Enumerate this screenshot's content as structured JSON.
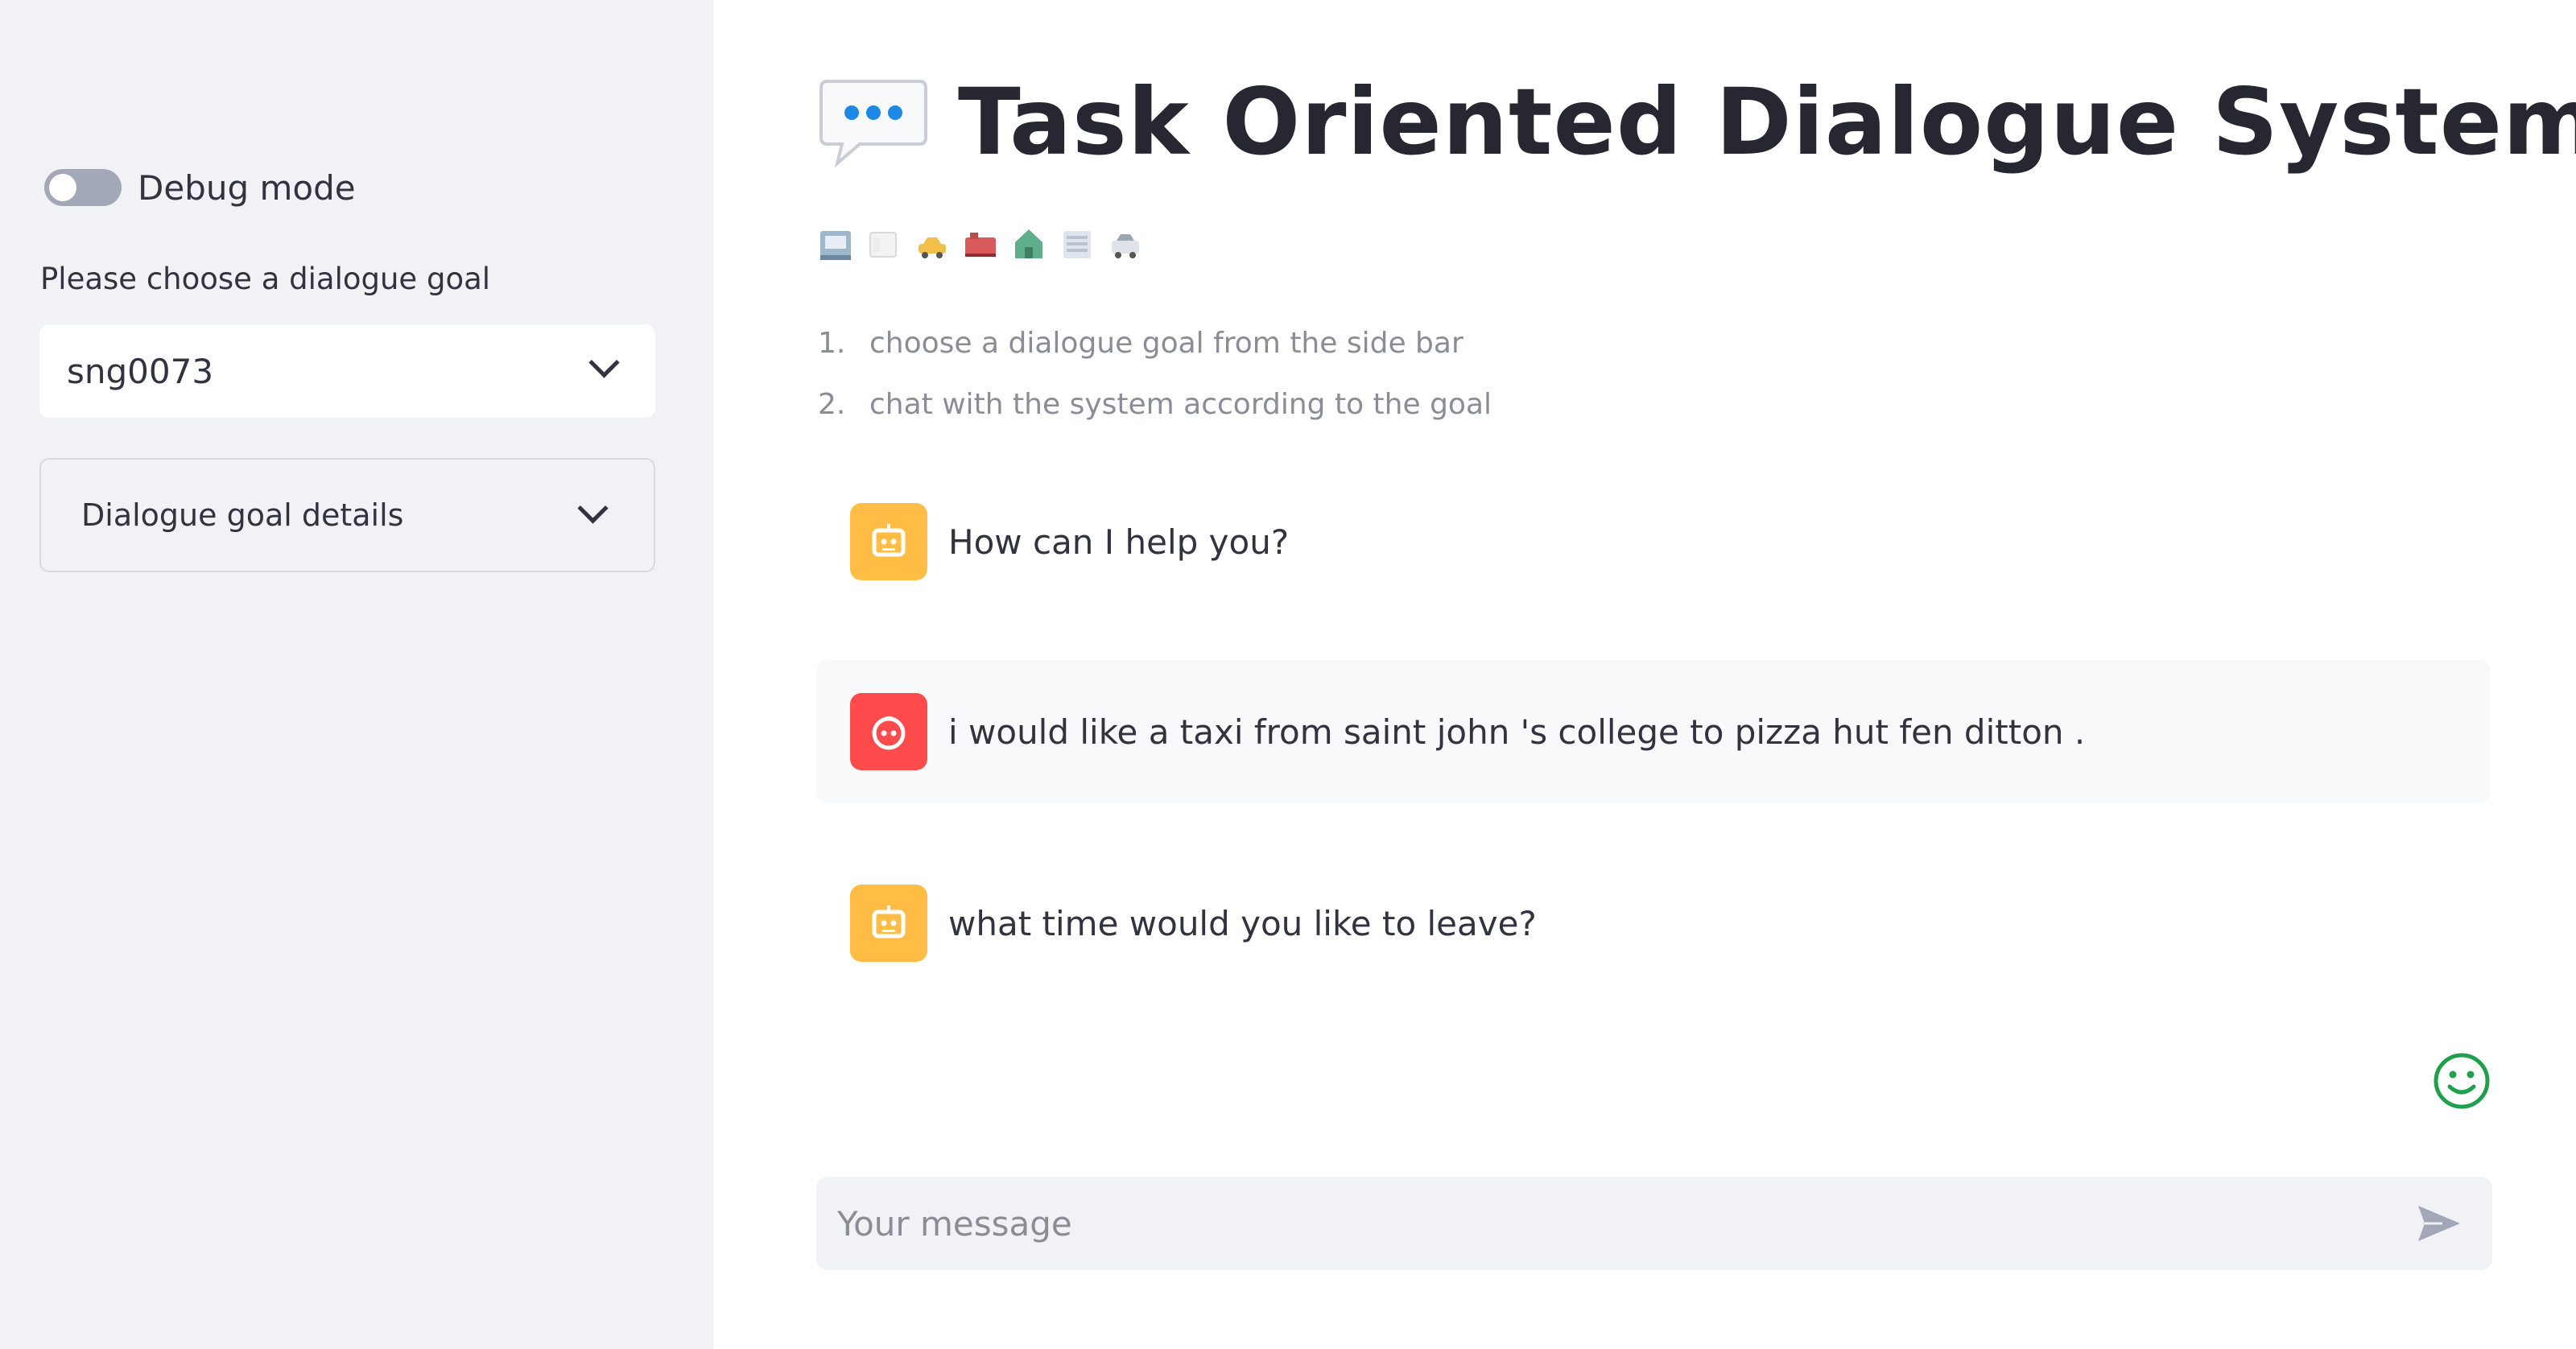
{
  "sidebar": {
    "debug_toggle": {
      "label": "Debug mode",
      "checked": false
    },
    "goal_select": {
      "label": "Please choose a dialogue goal",
      "value": "sng0073",
      "icon": "chevron-down-icon"
    },
    "goal_expander": {
      "label": "Dialogue goal details",
      "icon": "chevron-down-icon"
    }
  },
  "main": {
    "title": "Task Oriented Dialogue System",
    "title_icon": "speech-bubble-icon",
    "domain_icons": [
      "hotel-icon",
      "restaurant-icon",
      "taxi-icon",
      "train-icon",
      "attraction-icon",
      "hospital-icon",
      "police-icon"
    ],
    "instructions": [
      {
        "num": "1.",
        "text": "choose a dialogue goal from the side bar"
      },
      {
        "num": "2.",
        "text": "chat with the system according to the goal"
      }
    ],
    "messages": [
      {
        "role": "assistant",
        "text": "How can I help you?"
      },
      {
        "role": "user",
        "text": "i would like a taxi from saint john 's college to pizza hut fen ditton ."
      },
      {
        "role": "assistant",
        "text": "what time would you like to leave?"
      }
    ],
    "feedback_icon": "smiley-icon",
    "chat_input": {
      "placeholder": "Your message",
      "value": ""
    },
    "send_icon": "send-icon"
  },
  "colors": {
    "sidebar_bg": "#f0f2f6",
    "assistant_avatar": "#ffbd45",
    "user_avatar": "#ff4b4b",
    "bubble_blue": "#1e88e5",
    "smiley_green": "#21a04b"
  }
}
